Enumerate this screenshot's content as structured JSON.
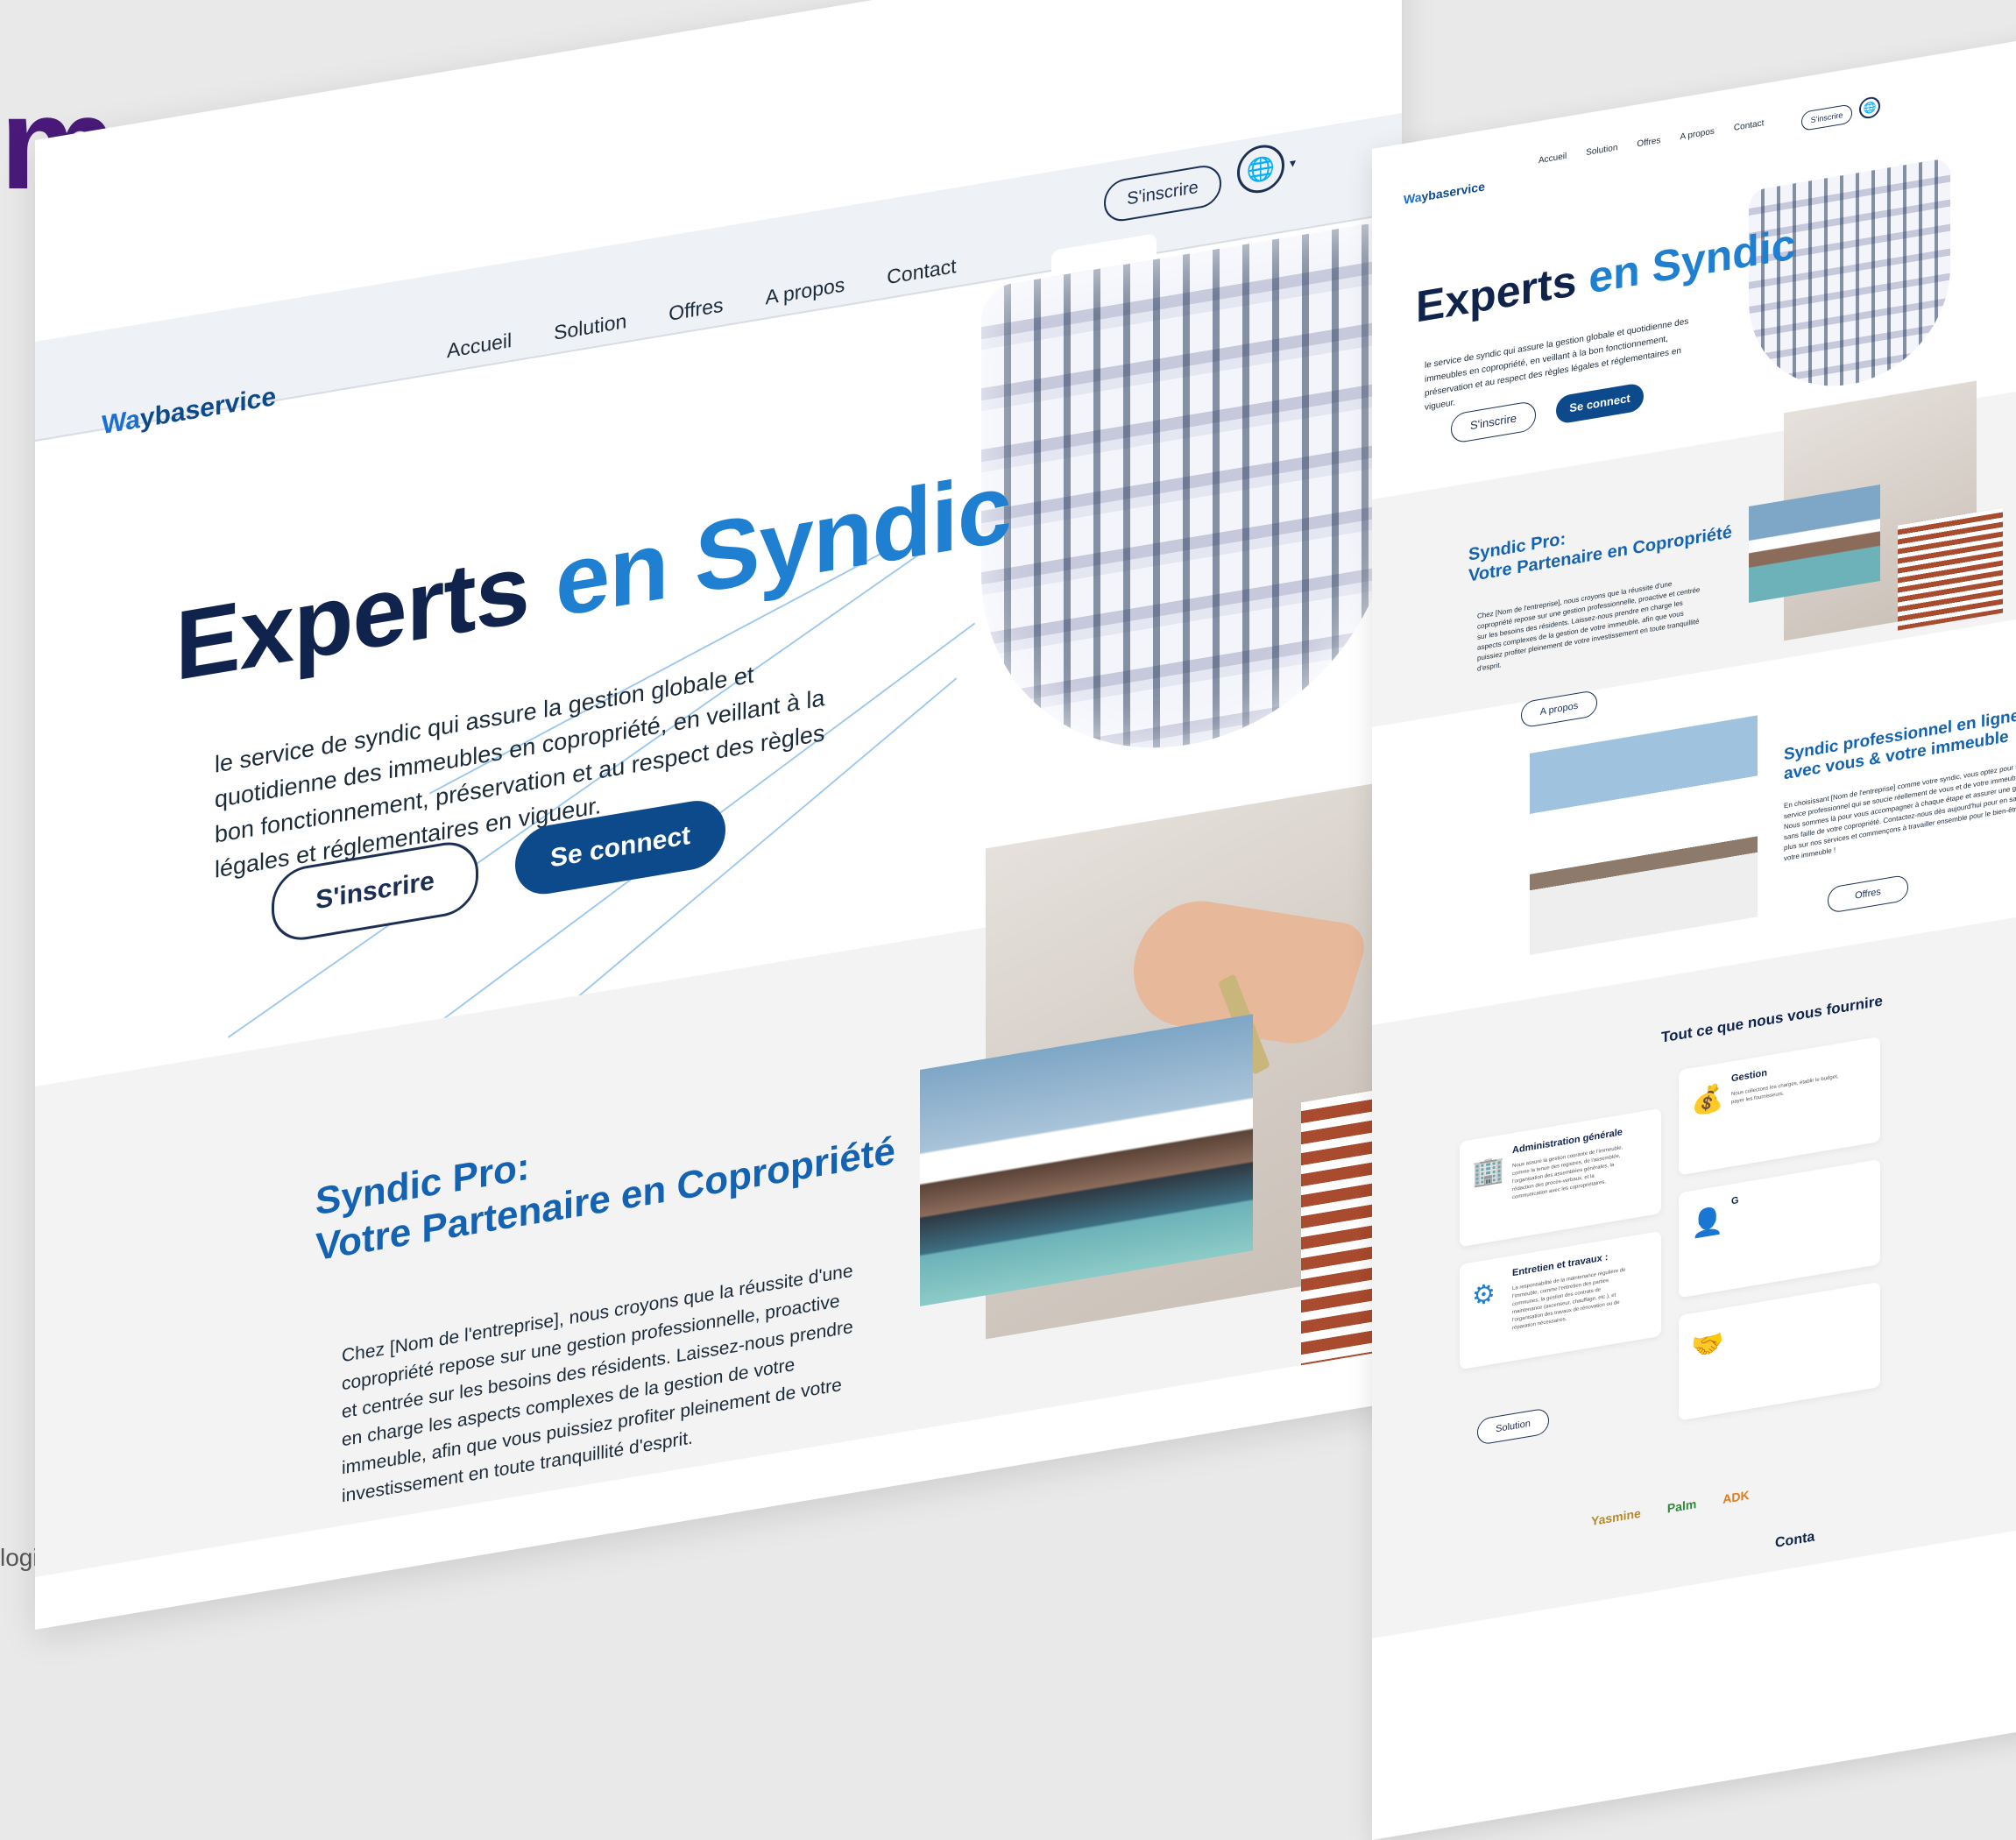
{
  "background": {
    "brand_fragment": "m",
    "category_fragment": "logie"
  },
  "colors": {
    "navy": "#10234d",
    "blue": "#1f7fd0",
    "button": "#0d4a8c",
    "accent_line": "#9cc7ee"
  },
  "main": {
    "nav": {
      "logo_w": "Wa",
      "logo_rest": "ybaservice",
      "menu": [
        "Accueil",
        "Solution",
        "Offres",
        "A propos",
        "Contact"
      ],
      "signup": "S'inscrire",
      "globe_icon": "globe-icon"
    },
    "hero": {
      "title_part1": "Experts",
      "title_part2": "en Syndic",
      "description": "le service de syndic qui assure la gestion globale et quotidienne des immeubles en copropriété, en veillant à la bon fonctionnement, préservation et au respect des règles légales et réglementaires en vigueur.",
      "signup_btn": "S'inscrire",
      "connect_btn": "Se connect"
    },
    "section2": {
      "title_line1": "Syndic Pro:",
      "title_line2": "Votre Partenaire en Copropriété",
      "description": "Chez [Nom de l'entreprise], nous croyons que la réussite d'une copropriété repose sur une gestion professionnelle, proactive et centrée sur les besoins des résidents. Laissez-nous prendre en charge les aspects complexes de la gestion de votre immeuble, afin que vous puissiez profiter pleinement de votre investissement en toute tranquillité d'esprit.",
      "button": "A propos"
    },
    "section3_title_fragment": "fessionnel en ligne\nuble."
  },
  "secondary": {
    "nav": {
      "logo_w": "Wa",
      "logo_rest": "ybaservice",
      "menu": [
        "Accueil",
        "Solution",
        "Offres",
        "A propos",
        "Contact"
      ],
      "signup": "S'inscrire"
    },
    "hero": {
      "title_part1": "Experts",
      "title_part2": "en Syndic",
      "description": "le service de syndic qui assure la gestion globale et quotidienne des immeubles en copropriété, en veillant à la bon fonctionnement, préservation et au respect des règles légales et réglementaires en vigueur.",
      "signup_btn": "S'inscrire",
      "connect_btn": "Se connect"
    },
    "section2": {
      "title_line1": "Syndic Pro:",
      "title_line2": "Votre Partenaire en Copropriété",
      "description": "Chez [Nom de l'entreprise], nous croyons que la réussite d'une copropriété repose sur une gestion professionnelle, proactive et centrée sur les besoins des résidents. Laissez-nous prendre en charge les aspects complexes de la gestion de votre immeuble, afin que vous puissiez profiter pleinement de votre investissement en toute tranquillité d'esprit.",
      "button": "A propos"
    },
    "section3": {
      "title_line1": "Syndic professionnel en ligne",
      "title_line2": "avec vous & votre immeuble",
      "description": "En choisissant [Nom de l'entreprise] comme votre syndic, vous optez pour un service professionnel qui se soucie réellement de vous et de votre immeuble. Nous sommes là pour vous accompagner à chaque étape et assurer une gestion sans faille de votre copropriété. Contactez-nous dès aujourd'hui pour en savoir plus sur nos services et commençons à travailler ensemble pour le bien-être de votre immeuble !",
      "button": "Offres"
    },
    "section4": {
      "title": "Tout ce que nous vous fournire",
      "cards": [
        {
          "icon": "building-icon",
          "title": "Administration générale",
          "desc": "Nous assure la gestion courante de l'immeuble, comme la tenue des registres, de l'assemblée, l'organisation des assemblées générales, la rédaction des procès-verbaux, et la communication avec les copropriétaires."
        },
        {
          "icon": "coins-icon",
          "title": "Gestion",
          "desc": "Nous collectons les charges, établir le budget, payer les fournisseurs."
        },
        {
          "icon": "gears-icon",
          "title": "Entretien et travaux :",
          "desc": "La responsabilité de la maintenance régulière de l'immeuble, comme l'entretien des parties communes, la gestion des contrats de maintenance (ascenseur, chauffage, etc.), et l'organisation des travaux de rénovation ou de réparation nécessaires."
        },
        {
          "icon": "user-icon",
          "title": "G",
          "desc": ""
        },
        {
          "icon": "handshake-icon",
          "title": "",
          "desc": ""
        }
      ],
      "button": "Solution"
    },
    "partners": [
      "Yasmine",
      "Palm",
      "ADK"
    ],
    "contact_fragment": "Conta"
  }
}
